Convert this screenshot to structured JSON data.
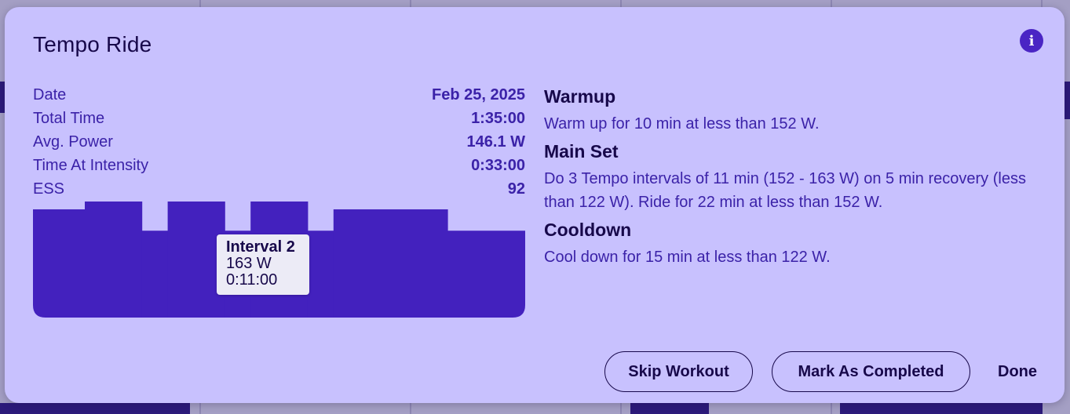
{
  "dialog": {
    "title": "Tempo Ride",
    "info_icon": "info-icon"
  },
  "stats": [
    {
      "label": "Date",
      "value": "Feb 25, 2025"
    },
    {
      "label": "Total Time",
      "value": "1:35:00"
    },
    {
      "label": "Avg. Power",
      "value": "146.1 W"
    },
    {
      "label": "Time At Intensity",
      "value": "0:33:00"
    },
    {
      "label": "ESS",
      "value": "92"
    }
  ],
  "chart_data": {
    "type": "bar",
    "x_unit": "min",
    "y_unit": "W",
    "segments": [
      {
        "duration": 10,
        "power": 152
      },
      {
        "duration": 11,
        "power": 163
      },
      {
        "duration": 5,
        "power": 122
      },
      {
        "duration": 11,
        "power": 163
      },
      {
        "duration": 5,
        "power": 122
      },
      {
        "duration": 11,
        "power": 163
      },
      {
        "duration": 5,
        "power": 122
      },
      {
        "duration": 22,
        "power": 152
      },
      {
        "duration": 15,
        "power": 122
      }
    ],
    "ylim": [
      0,
      163
    ],
    "color": "#4321be",
    "tooltip": {
      "title": "Interval 2",
      "power": "163 W",
      "time": "0:11:00"
    }
  },
  "description": {
    "sections": [
      {
        "title": "Warmup",
        "text": "Warm up for 10 min at less than 152 W."
      },
      {
        "title": "Main Set",
        "text": "Do 3 Tempo intervals of 11 min (152 - 163 W) on 5 min recovery (less than 122 W). Ride for 22 min at less than 152 W."
      },
      {
        "title": "Cooldown",
        "text": "Cool down for 15 min at less than 122 W."
      }
    ]
  },
  "actions": {
    "skip_label": "Skip Workout",
    "complete_label": "Mark As Completed",
    "done_label": "Done"
  },
  "colors": {
    "dialog_bg": "#c8c1fe",
    "accent": "#4321be",
    "text_dark": "#17084a",
    "text_accent": "#3b22a8"
  }
}
